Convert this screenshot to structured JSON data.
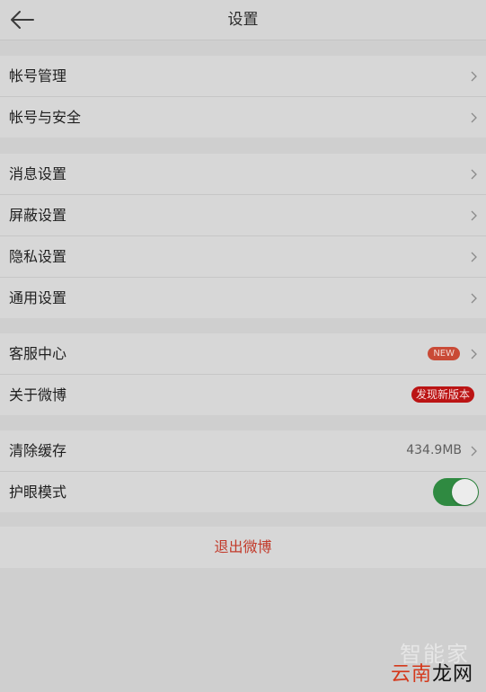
{
  "header": {
    "title": "设置",
    "back_icon": "arrow-left-icon"
  },
  "groups": [
    {
      "items": [
        {
          "label": "帐号管理"
        },
        {
          "label": "帐号与安全"
        }
      ]
    },
    {
      "items": [
        {
          "label": "消息设置"
        },
        {
          "label": "屏蔽设置"
        },
        {
          "label": "隐私设置"
        },
        {
          "label": "通用设置"
        }
      ]
    },
    {
      "items": [
        {
          "label": "客服中心",
          "badge": "NEW"
        },
        {
          "label": "关于微博",
          "badge": "发现新版本"
        }
      ]
    },
    {
      "items": [
        {
          "label": "清除缓存",
          "value": "434.9MB"
        },
        {
          "label": "护眼模式",
          "toggle_on": true
        }
      ]
    }
  ],
  "logout_label": "退出微博",
  "watermark": {
    "line1": "智能家",
    "line2_a": "云南",
    "line2_b": "龙网"
  },
  "colors": {
    "accent_red": "#c23a2a",
    "toggle_on": "#2f8a41",
    "badge_new": "#c94a36",
    "badge_update": "#bb1414"
  }
}
